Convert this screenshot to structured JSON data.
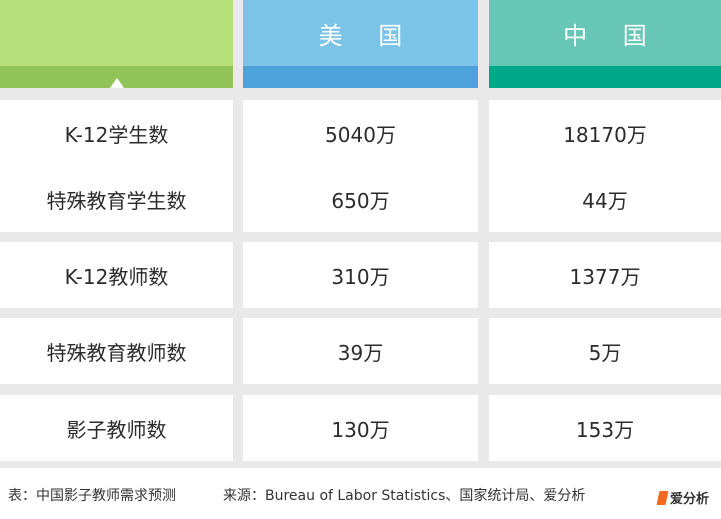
{
  "chart_data": {
    "type": "table",
    "columns": [
      "",
      "美 国",
      "中 国"
    ],
    "rows": [
      {
        "label": "K-12学生数",
        "values": [
          "5040万",
          "18170万"
        ]
      },
      {
        "label": "特殊教育学生数",
        "values": [
          "650万",
          "44万"
        ]
      },
      {
        "label": "K-12教师数",
        "values": [
          "310万",
          "1377万"
        ]
      },
      {
        "label": "特殊教育教师数",
        "values": [
          "39万",
          "5万"
        ]
      },
      {
        "label": "影子教师数",
        "values": [
          "130万",
          "153万"
        ]
      }
    ]
  },
  "footer": {
    "note": "表：中国影子教师需求预测",
    "source": "来源：Bureau of Labor Statistics、国家统计局、爱分析",
    "logo_text": "爱分析"
  },
  "colors": {
    "col0_top": "#b5e07a",
    "col0_bar": "#92c45a",
    "col1_top": "#7cc3e8",
    "col1_bar": "#4ea2dc",
    "col2_top": "#67c6b6",
    "col2_bar": "#00a88a",
    "logo_accent": "#f26a21"
  }
}
